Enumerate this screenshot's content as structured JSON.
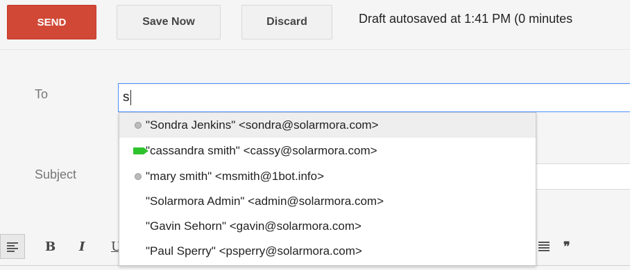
{
  "toolbar": {
    "send_label": "SEND",
    "save_label": "Save Now",
    "discard_label": "Discard",
    "status_text": "Draft autosaved at 1:41 PM (0 minutes"
  },
  "fields": {
    "to_label": "To",
    "to_value": "s",
    "subject_label": "Subject"
  },
  "suggestions": [
    {
      "text": "\"Sondra Jenkins\" <sondra@solarmora.com>",
      "indicator": "presence-dot-icon",
      "highlighted": true
    },
    {
      "text": "\"cassandra smith\" <cassy@solarmora.com>",
      "indicator": "video-camera-icon",
      "highlighted": false
    },
    {
      "text": "\"mary smith\" <msmith@1bot.info>",
      "indicator": "presence-dot-icon",
      "highlighted": false
    },
    {
      "text": "\"Solarmora Admin\" <admin@solarmora.com>",
      "indicator": "none",
      "highlighted": false
    },
    {
      "text": "\"Gavin Sehorn\" <gavin@solarmora.com>",
      "indicator": "none",
      "highlighted": false
    },
    {
      "text": "\"Paul Sperry\" <psperry@solarmora.com>",
      "indicator": "none",
      "highlighted": false
    }
  ],
  "formatting": {
    "bold": "B",
    "italic": "I",
    "underline": "U",
    "quote": "❞"
  },
  "colors": {
    "send_button": "#d14836",
    "focus_border": "#4d90fe",
    "video_icon": "#2ec32e"
  }
}
